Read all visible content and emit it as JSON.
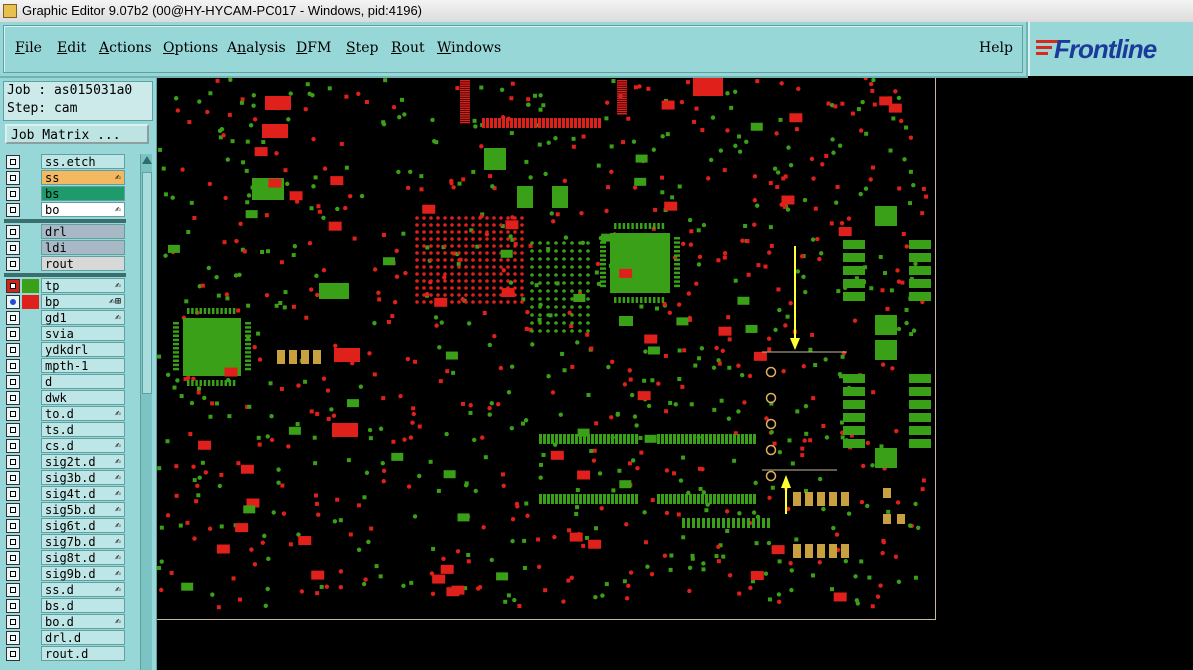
{
  "window": {
    "title": "Graphic Editor 9.07b2 (00@HY-HYCAM-PC017 - Windows, pid:4196)"
  },
  "menu": {
    "items": [
      {
        "label": "File",
        "accel": "F"
      },
      {
        "label": "Edit",
        "accel": "E"
      },
      {
        "label": "Actions",
        "accel": "A"
      },
      {
        "label": "Options",
        "accel": "O"
      },
      {
        "label": "Analysis",
        "accel": "n"
      },
      {
        "label": "DFM",
        "accel": "D"
      },
      {
        "label": "Step",
        "accel": "S"
      },
      {
        "label": "Rout",
        "accel": "R"
      },
      {
        "label": "Windows",
        "accel": "W"
      }
    ],
    "help": "Help"
  },
  "logo": {
    "text": "Frontline"
  },
  "job": {
    "job_line": "Job : as015031a0",
    "step_line": "Step: cam"
  },
  "job_matrix_button": "Job Matrix ...",
  "layers": [
    {
      "name": "ss.etch",
      "color": "",
      "name_bg": "#bfe6e6",
      "check": "plain",
      "mark": ""
    },
    {
      "name": "ss",
      "color": "",
      "name_bg": "#f4b860",
      "check": "plain",
      "mark": "✍"
    },
    {
      "name": "bs",
      "color": "",
      "name_bg": "#1f9a6a",
      "check": "plain",
      "mark": ""
    },
    {
      "name": "bo",
      "color": "",
      "name_bg": "#ffffff",
      "check": "plain",
      "mark": "✍"
    },
    {
      "name": "drl",
      "color": "",
      "name_bg": "#a8b8c4",
      "check": "plain",
      "mark": ""
    },
    {
      "name": "ldi",
      "color": "",
      "name_bg": "#a8b8c4",
      "check": "plain",
      "mark": ""
    },
    {
      "name": "rout",
      "color": "",
      "name_bg": "#d8d8d8",
      "check": "plain",
      "mark": ""
    },
    {
      "name": "tp",
      "color": "#3aa018",
      "name_bg": "#bfe6e6",
      "check": "red",
      "mark": "✍"
    },
    {
      "name": "bp",
      "color": "#e0201a",
      "name_bg": "#bfe6e6",
      "check": "blue",
      "mark": "✍⊞"
    },
    {
      "name": "gd1",
      "color": "",
      "name_bg": "#bfe6e6",
      "check": "plain",
      "mark": "✍"
    },
    {
      "name": "svia",
      "color": "",
      "name_bg": "#bfe6e6",
      "check": "plain",
      "mark": ""
    },
    {
      "name": "ydkdrl",
      "color": "",
      "name_bg": "#bfe6e6",
      "check": "plain",
      "mark": ""
    },
    {
      "name": "mpth-1",
      "color": "",
      "name_bg": "#bfe6e6",
      "check": "plain",
      "mark": ""
    },
    {
      "name": "d",
      "color": "",
      "name_bg": "#bfe6e6",
      "check": "plain",
      "mark": ""
    },
    {
      "name": "dwk",
      "color": "",
      "name_bg": "#bfe6e6",
      "check": "plain",
      "mark": ""
    },
    {
      "name": "to.d",
      "color": "",
      "name_bg": "#bfe6e6",
      "check": "plain",
      "mark": "✍"
    },
    {
      "name": "ts.d",
      "color": "",
      "name_bg": "#bfe6e6",
      "check": "plain",
      "mark": ""
    },
    {
      "name": "cs.d",
      "color": "",
      "name_bg": "#bfe6e6",
      "check": "plain",
      "mark": "✍"
    },
    {
      "name": "sig2t.d",
      "color": "",
      "name_bg": "#bfe6e6",
      "check": "plain",
      "mark": "✍"
    },
    {
      "name": "sig3b.d",
      "color": "",
      "name_bg": "#bfe6e6",
      "check": "plain",
      "mark": "✍"
    },
    {
      "name": "sig4t.d",
      "color": "",
      "name_bg": "#bfe6e6",
      "check": "plain",
      "mark": "✍"
    },
    {
      "name": "sig5b.d",
      "color": "",
      "name_bg": "#bfe6e6",
      "check": "plain",
      "mark": "✍"
    },
    {
      "name": "sig6t.d",
      "color": "",
      "name_bg": "#bfe6e6",
      "check": "plain",
      "mark": "✍"
    },
    {
      "name": "sig7b.d",
      "color": "",
      "name_bg": "#bfe6e6",
      "check": "plain",
      "mark": "✍"
    },
    {
      "name": "sig8t.d",
      "color": "",
      "name_bg": "#bfe6e6",
      "check": "plain",
      "mark": "✍"
    },
    {
      "name": "sig9b.d",
      "color": "",
      "name_bg": "#bfe6e6",
      "check": "plain",
      "mark": "✍"
    },
    {
      "name": "ss.d",
      "color": "",
      "name_bg": "#bfe6e6",
      "check": "plain",
      "mark": "✍"
    },
    {
      "name": "bs.d",
      "color": "",
      "name_bg": "#bfe6e6",
      "check": "plain",
      "mark": ""
    },
    {
      "name": "bo.d",
      "color": "",
      "name_bg": "#bfe6e6",
      "check": "plain",
      "mark": "✍"
    },
    {
      "name": "drl.d",
      "color": "",
      "name_bg": "#bfe6e6",
      "check": "plain",
      "mark": ""
    },
    {
      "name": "rout.d",
      "color": "",
      "name_bg": "#bfe6e6",
      "check": "plain",
      "mark": ""
    }
  ],
  "colors": {
    "top_paste": "#3aa018",
    "bottom_paste": "#e0201a",
    "overlap": "#c8a040",
    "annotation": "#ffff33"
  }
}
